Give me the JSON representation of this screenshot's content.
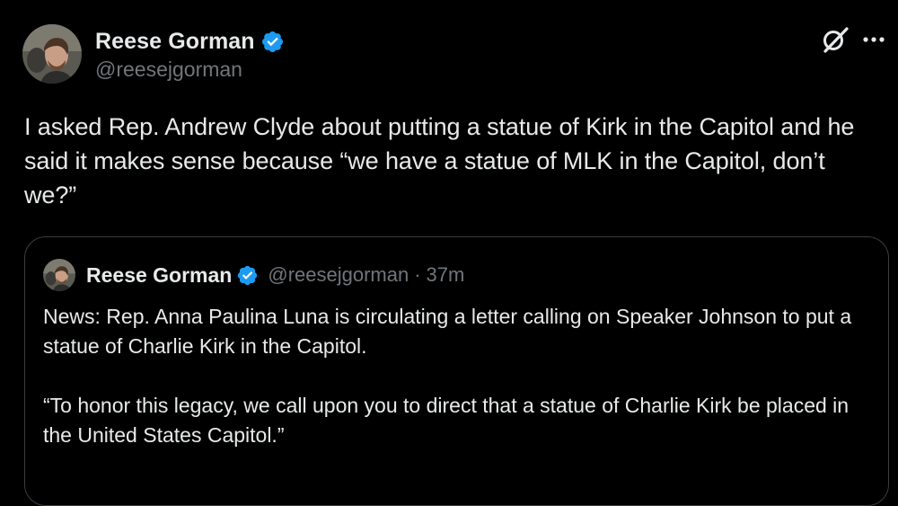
{
  "author": {
    "display_name": "Reese Gorman",
    "handle": "@reesejgorman",
    "verified": true,
    "verified_color": "#1d9bf0"
  },
  "actions": {
    "grok_icon": "grok-icon",
    "more_icon": "more-options-icon"
  },
  "tweet": {
    "text": "I asked Rep. Andrew Clyde about putting a statue of Kirk in the Capitol and he said it makes sense because “we have a statue of MLK in the Capitol, don’t we?”"
  },
  "quote": {
    "display_name": "Reese Gorman",
    "handle": "@reesejgorman",
    "separator": "·",
    "time": "37m",
    "paragraphs": [
      "News: Rep. Anna Paulina Luna is circulating a letter calling on Speaker Johnson to put a statue of Charlie Kirk in the Capitol.",
      "“To honor this legacy, we call upon you to direct that a statue of Charlie Kirk be placed in the United States Capitol.”"
    ]
  },
  "colors": {
    "background": "#000000",
    "primary_text": "#e7e9ea",
    "secondary_text": "#71767b",
    "border": "#3a3d41"
  }
}
